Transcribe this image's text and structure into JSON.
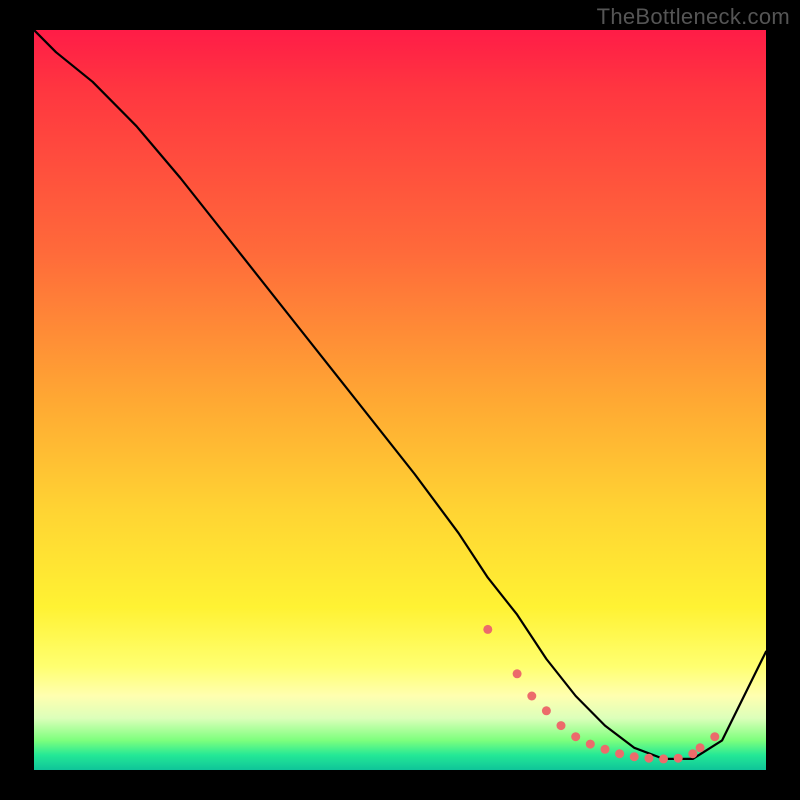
{
  "watermark": "TheBottleneck.com",
  "chart_data": {
    "type": "line",
    "title": "",
    "xlabel": "",
    "ylabel": "",
    "ylim": [
      0,
      100
    ],
    "xlim": [
      0,
      100
    ],
    "series": [
      {
        "name": "curve",
        "x": [
          0,
          3,
          8,
          14,
          20,
          28,
          36,
          44,
          52,
          58,
          62,
          66,
          70,
          74,
          78,
          82,
          86,
          90,
          94,
          100
        ],
        "values": [
          100,
          97,
          93,
          87,
          80,
          70,
          60,
          50,
          40,
          32,
          26,
          21,
          15,
          10,
          6,
          3,
          1.5,
          1.5,
          4,
          16
        ]
      }
    ],
    "markers": {
      "name": "dots",
      "x": [
        62,
        66,
        68,
        70,
        72,
        74,
        76,
        78,
        80,
        82,
        84,
        86,
        88,
        90,
        91,
        93
      ],
      "values": [
        19,
        13,
        10,
        8,
        6,
        4.5,
        3.5,
        2.8,
        2.2,
        1.8,
        1.6,
        1.5,
        1.6,
        2.2,
        3.0,
        4.5
      ]
    },
    "gradient_stops": [
      {
        "pos": 0.0,
        "color": "#ff1c47"
      },
      {
        "pos": 0.3,
        "color": "#ff6a3a"
      },
      {
        "pos": 0.65,
        "color": "#ffd433"
      },
      {
        "pos": 0.9,
        "color": "#ffffb0"
      },
      {
        "pos": 1.0,
        "color": "#0fc499"
      }
    ]
  }
}
